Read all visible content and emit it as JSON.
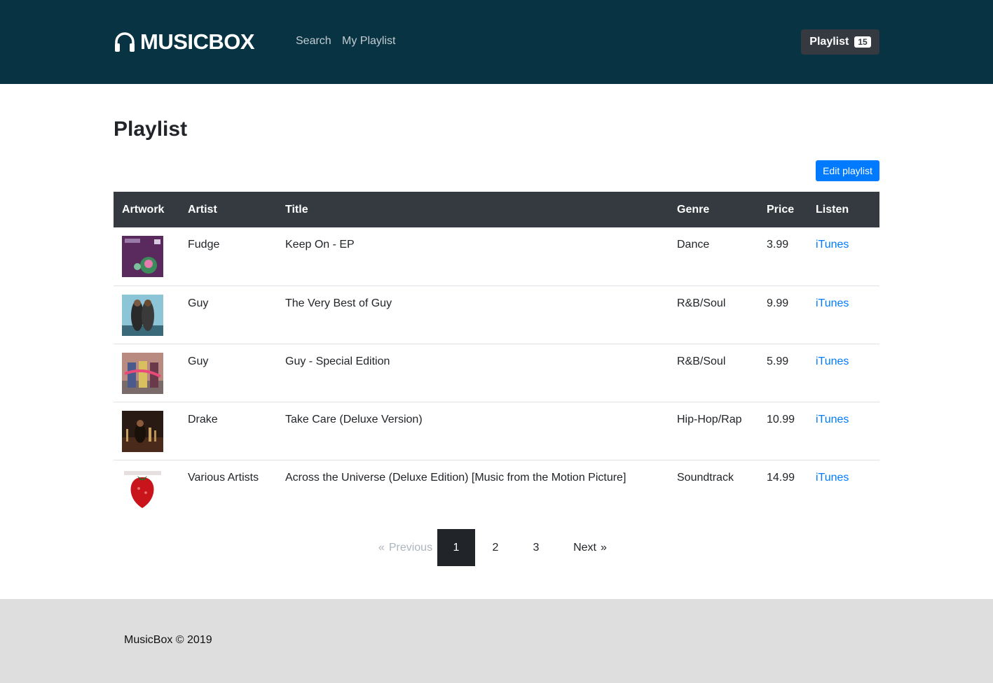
{
  "navbar": {
    "brand": "MUSICBOX",
    "links": [
      "Search",
      "My Playlist"
    ],
    "playlist_button": {
      "label": "Playlist",
      "count": "15"
    }
  },
  "page": {
    "title": "Playlist",
    "edit_button": "Edit playlist"
  },
  "table": {
    "headers": [
      "Artwork",
      "Artist",
      "Title",
      "Genre",
      "Price",
      "Listen"
    ],
    "rows": [
      {
        "artist": "Fudge",
        "title": "Keep On - EP",
        "genre": "Dance",
        "price": "3.99",
        "listen": "iTunes"
      },
      {
        "artist": "Guy",
        "title": "The Very Best of Guy",
        "genre": "R&B/Soul",
        "price": "9.99",
        "listen": "iTunes"
      },
      {
        "artist": "Guy",
        "title": "Guy - Special Edition",
        "genre": "R&B/Soul",
        "price": "5.99",
        "listen": "iTunes"
      },
      {
        "artist": "Drake",
        "title": "Take Care (Deluxe Version)",
        "genre": "Hip-Hop/Rap",
        "price": "10.99",
        "listen": "iTunes"
      },
      {
        "artist": "Various Artists",
        "title": "Across the Universe (Deluxe Edition) [Music from the Motion Picture]",
        "genre": "Soundtrack",
        "price": "14.99",
        "listen": "iTunes"
      }
    ]
  },
  "pagination": {
    "prev_symbol": "«",
    "prev": "Previous",
    "pages": [
      "1",
      "2",
      "3"
    ],
    "current": "1",
    "next": "Next",
    "next_symbol": "»"
  },
  "footer": {
    "text": "MusicBox © 2019"
  },
  "colors": {
    "navbar": "#073342",
    "accent": "#007bff",
    "table_header": "#343a40",
    "footer": "#dedede"
  }
}
